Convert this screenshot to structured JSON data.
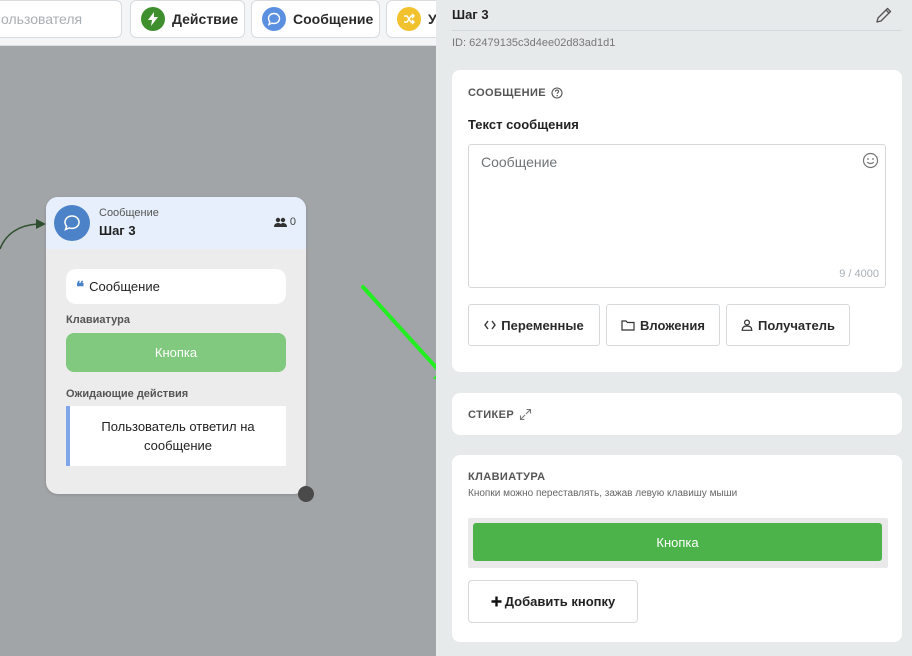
{
  "toolbar": {
    "search_placeholder": "ользователя",
    "buttons": [
      {
        "label": "Действие",
        "icon": "lightning-icon",
        "color": "#3f8f2f"
      },
      {
        "label": "Сообщение",
        "icon": "chat-bubble-icon",
        "color": "#5b8fe0"
      },
      {
        "label": "У",
        "icon": "shuffle-icon",
        "color": "#f2c22e"
      }
    ]
  },
  "node": {
    "type": "Сообщение",
    "title": "Шаг 3",
    "user_count": "0",
    "message": "Сообщение",
    "keyboard_label": "Клавиатура",
    "keyboard_button": "Кнопка",
    "waiting_label": "Ожидающие действия",
    "waiting_action": "Пользователь ответил на сообщение",
    "header_color": "#e6effb",
    "icon_color": "#4c82c8",
    "button_color": "#80c97e"
  },
  "panel": {
    "title": "Шаг 3",
    "id": "ID: 62479135c3d4ee02d83ad1d1",
    "message_section": {
      "title": "СООБЩЕНИЕ",
      "field_label": "Текст сообщения",
      "placeholder": "Сообщение",
      "counter": "9 / 4000",
      "buttons": [
        "Переменные",
        "Вложения",
        "Получатель"
      ]
    },
    "sticker_section": {
      "title": "СТИКЕР"
    },
    "keyboard_section": {
      "title": "КЛАВИАТУРА",
      "subtitle": "Кнопки можно переставлять, зажав левую клавишу мыши",
      "button_label": "Кнопка",
      "add_label": "Добавить кнопку",
      "button_color": "#4bb34a"
    }
  },
  "annotation": {
    "arrow_color": "#22ee22"
  }
}
